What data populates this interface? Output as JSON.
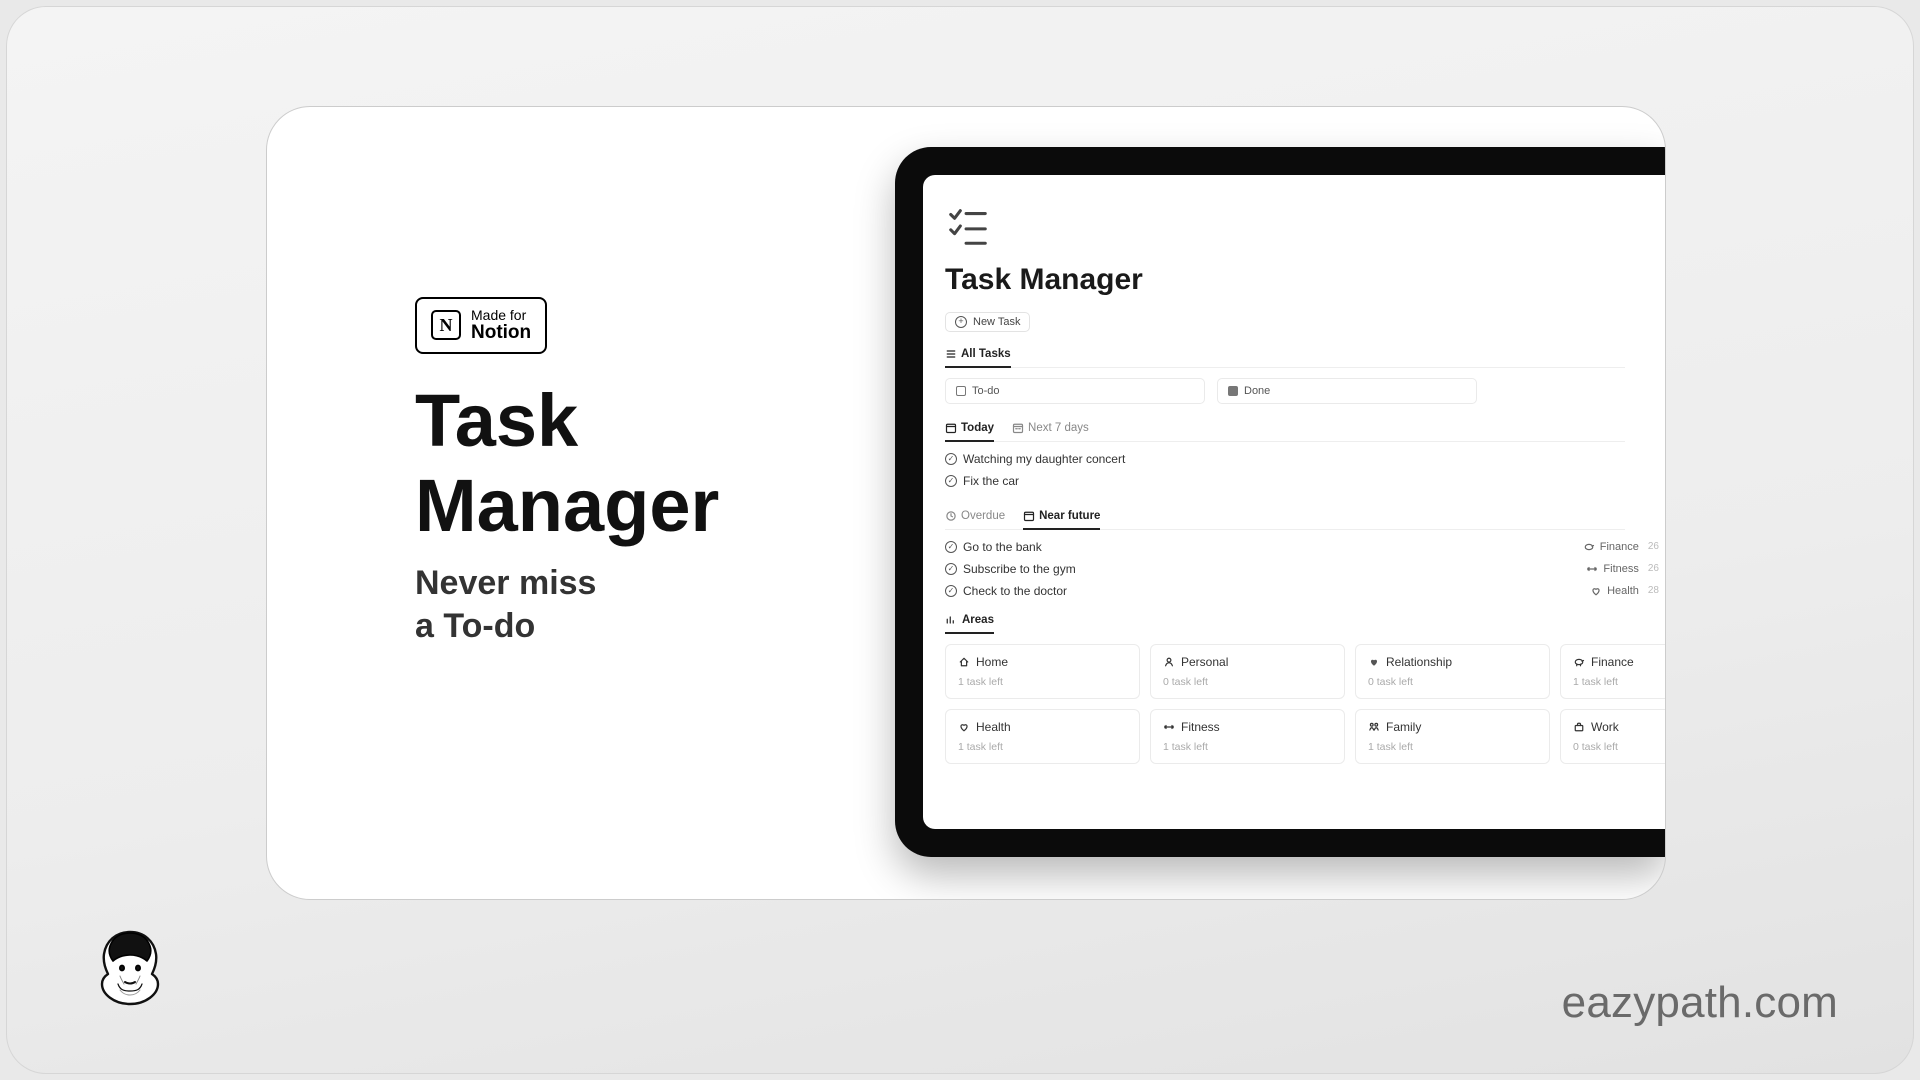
{
  "badge": {
    "line1": "Made for",
    "line2": "Notion",
    "glyph": "N"
  },
  "title": {
    "l1": "Task",
    "l2": "Manager"
  },
  "subtitle": {
    "l1": "Never miss",
    "l2": "a To-do"
  },
  "brand": "eazypath.com",
  "app": {
    "title": "Task Manager",
    "newTask": "New Task",
    "allTasks": "All Tasks",
    "status": {
      "todo": "To-do",
      "done": "Done"
    },
    "timeTabs": {
      "today": "Today",
      "next7": "Next 7 days"
    },
    "todayTasks": [
      {
        "label": "Watching my daughter concert"
      },
      {
        "label": "Fix the car"
      }
    ],
    "rangeTabs": {
      "overdue": "Overdue",
      "near": "Near future"
    },
    "futureTasks": [
      {
        "label": "Go to the bank",
        "tag": "Finance",
        "tagIcon": "piggy",
        "date": "26"
      },
      {
        "label": "Subscribe to the gym",
        "tag": "Fitness",
        "tagIcon": "dumbbell",
        "date": "26"
      },
      {
        "label": "Check to the doctor",
        "tag": "Health",
        "tagIcon": "heart",
        "date": "28"
      }
    ],
    "areasLabel": "Areas",
    "areas": [
      {
        "icon": "home",
        "name": "Home",
        "sub": "1 task left"
      },
      {
        "icon": "person",
        "name": "Personal",
        "sub": "0 task left"
      },
      {
        "icon": "heart2",
        "name": "Relationship",
        "sub": "0 task left"
      },
      {
        "icon": "piggy",
        "name": "Finance",
        "sub": "1 task left"
      },
      {
        "icon": "heart",
        "name": "Health",
        "sub": "1 task left"
      },
      {
        "icon": "dumbbell",
        "name": "Fitness",
        "sub": "1 task left"
      },
      {
        "icon": "family",
        "name": "Family",
        "sub": "1 task left"
      },
      {
        "icon": "brief",
        "name": "Work",
        "sub": "0 task left"
      }
    ]
  }
}
